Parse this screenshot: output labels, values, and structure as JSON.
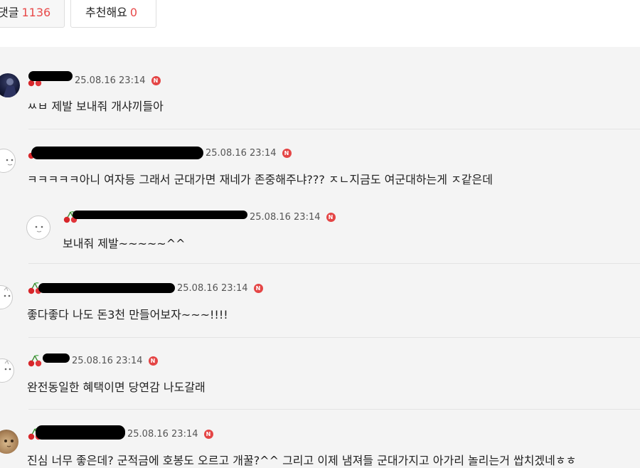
{
  "tabs": {
    "comments_label": "댓글",
    "comments_count": "1136",
    "recommend_label": "추천해요",
    "recommend_count": "0"
  },
  "colors": {
    "accent": "#e84a4a",
    "badge": "#e44545",
    "list_bg": "#f4f4f4"
  },
  "icons": {
    "level": "cherry-icon",
    "badge": "new-badge-icon"
  },
  "comments": [
    {
      "date": "25.08.16 23:14",
      "badge": "N",
      "text": "ㅆㅂ 제발 보내줘 개샤끼들아"
    },
    {
      "date": "25.08.16 23:14",
      "badge": "N",
      "text": "ㅋㅋㅋㅋㅋ아니 여자등 그래서 군대가면 재네가 존중해주냐??? ㅈㄴ지금도 여군대하는게 ㅈ같은데"
    },
    {
      "date": "25.08.16 23:14",
      "badge": "N",
      "text": "보내줘 제발~~~~~^^"
    },
    {
      "date": "25.08.16 23:14",
      "badge": "N",
      "text": "좋다좋다 나도 돈3천 만들어보자~~~!!!!"
    },
    {
      "date": "25.08.16 23:14",
      "badge": "N",
      "text": "완전동일한 혜택이면 당연감 나도갈래"
    },
    {
      "date": "25.08.16 23:14",
      "badge": "N",
      "text": "진심 너무 좋은데? 군적금에 호봉도 오르고 개꿀?^^ 그리고 이제 냄져들 군대가지고 아가리 놀리는거 쌉치겠네ㅎㅎ"
    }
  ]
}
